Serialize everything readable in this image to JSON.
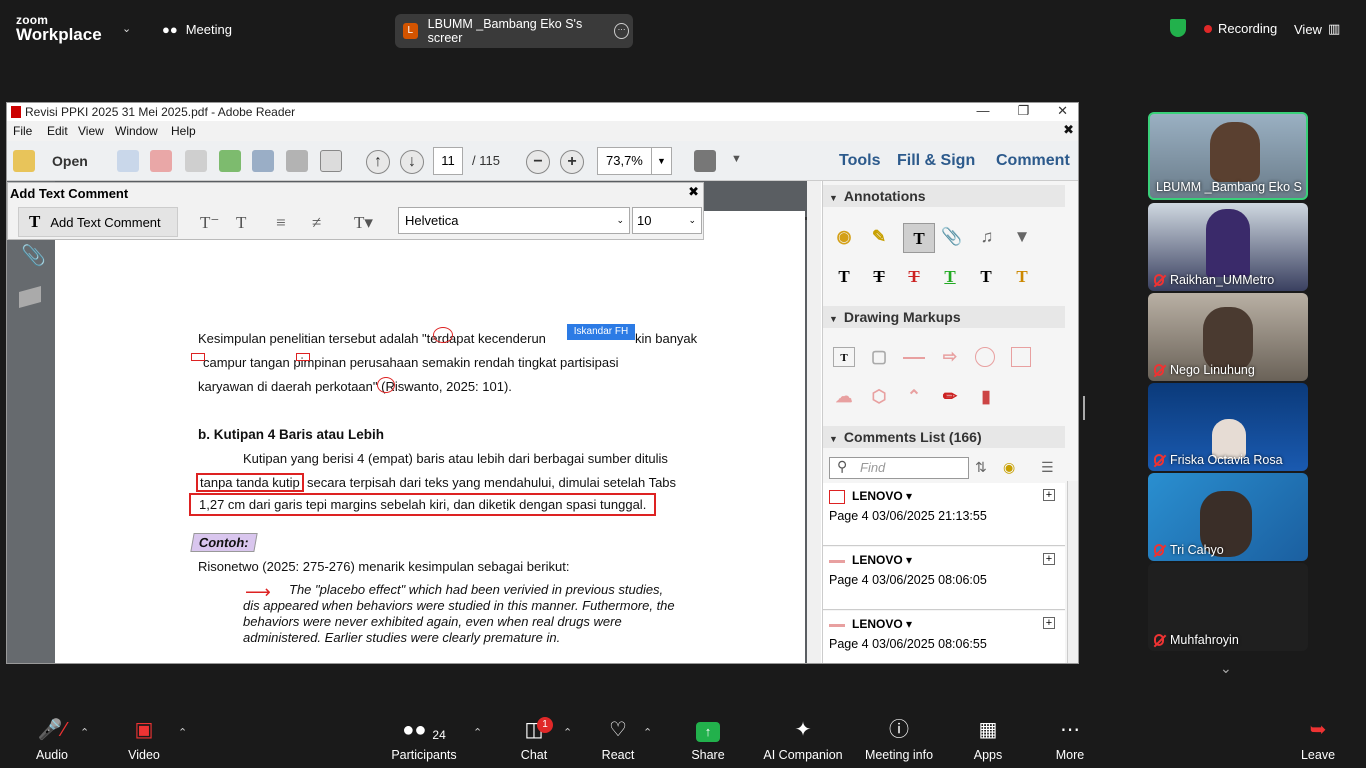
{
  "zoom": {
    "logo_line1": "zoom",
    "logo_line2": "Workplace",
    "meeting_label": "Meeting",
    "share_title": "LBUMM _Bambang Eko S's screer",
    "share_initial": "L",
    "recording_label": "Recording",
    "view_label": "View"
  },
  "adobe": {
    "window_title": "Revisi PPKI 2025 31 Mei 2025.pdf - Adobe Reader",
    "menu": [
      "File",
      "Edit",
      "View",
      "Window",
      "Help"
    ],
    "open_label": "Open",
    "page_current": "11",
    "page_total": "/ 115",
    "zoom_value": "73,7%",
    "right_tabs": [
      "Tools",
      "Fill & Sign",
      "Comment"
    ],
    "text_comment": {
      "header": "Add Text Comment",
      "button_label": "Add Text Comment",
      "font": "Helvetica",
      "size": "10"
    },
    "document": {
      "p1_line1": "Kesimpulan penelitian tersebut adalah \"terdapat kecenderun",
      "p1_line1_end": "kin banyak",
      "p1_line2": "campur   tangan   pimpinan   perusahaan   semakin   rendah   tingkat   partisipasi",
      "p1_line3": "karyawan di daerah perkotaan\" (Riswanto, 2025: 101).",
      "tooltip": "Iskandar FH",
      "heading": "b.   Kutipan 4 Baris atau Lebih",
      "p2_line1": "Kutipan yang berisi 4 (empat) baris atau lebih dari berbagai sumber ditulis",
      "p2_line2_a": "tanpa tanda kutip",
      "p2_line2_b": "secara terpisah dari teks yang mendahului, dimulai setelah Tabs",
      "p2_line3": "1,27 cm dari garis tepi margins sebelah kiri, dan diketik dengan spasi tunggal.",
      "contoh": "Contoh:",
      "p3": "Risonetwo (2025: 275-276) menarik kesimpulan sebagai berikut:",
      "q1": "The \"placebo effect\" which had been verivied in previous studies,",
      "q2": "dis appeared when behaviors were studied in this manner. Futhermore, the",
      "q3": "behaviors  were  never  exhibited  again,  even  when  real  drugs  were",
      "q4": "administered. Earlier studies were clearly premature in."
    },
    "panel": {
      "annotations": "Annotations",
      "drawing_markups": "Drawing Markups",
      "comments_list": "Comments List (166)",
      "find_placeholder": "Find",
      "comments": [
        {
          "author": "LENOVO",
          "meta": "Page 4  03/06/2025 21:13:55"
        },
        {
          "author": "LENOVO",
          "meta": "Page 4  03/06/2025 08:06:05"
        },
        {
          "author": "LENOVO",
          "meta": "Page 4  03/06/2025 08:06:55"
        }
      ]
    }
  },
  "participants": [
    {
      "name": "LBUMM _Bambang Eko S"
    },
    {
      "name": "Raikhan_UMMetro"
    },
    {
      "name": "Nego Linuhung"
    },
    {
      "name": "Friska Octavia Rosa"
    },
    {
      "name": "Tri Cahyo"
    },
    {
      "name": "Muhfahroyin"
    }
  ],
  "bottombar": {
    "audio": "Audio",
    "video": "Video",
    "participants": "Participants",
    "participants_count": "24",
    "chat": "Chat",
    "chat_badge": "1",
    "react": "React",
    "share": "Share",
    "ai": "AI Companion",
    "info": "Meeting info",
    "apps": "Apps",
    "more": "More",
    "leave": "Leave"
  },
  "colors": {
    "share_green": "#22b14c",
    "recording_red": "#e02828",
    "accent_blue": "#2c7be5"
  }
}
